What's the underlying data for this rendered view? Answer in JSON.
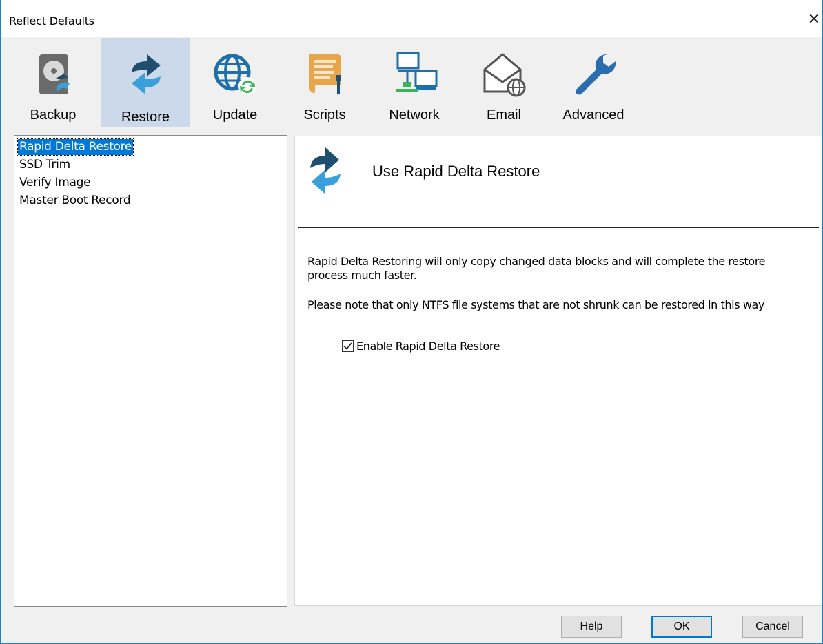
{
  "window": {
    "title": "Reflect Defaults",
    "close_glyph": "✕"
  },
  "toolbar": {
    "items": [
      {
        "label": "Backup",
        "icon": "backup-disk-icon"
      },
      {
        "label": "Restore",
        "icon": "restore-arrows-icon",
        "active": true
      },
      {
        "label": "Update",
        "icon": "update-globe-icon"
      },
      {
        "label": "Scripts",
        "icon": "scripts-scroll-icon"
      },
      {
        "label": "Network",
        "icon": "network-computers-icon"
      },
      {
        "label": "Email",
        "icon": "email-envelope-icon"
      },
      {
        "label": "Advanced",
        "icon": "wrench-icon"
      }
    ]
  },
  "sidebar": {
    "items": [
      {
        "label": "Rapid Delta Restore",
        "selected": true
      },
      {
        "label": "SSD Trim"
      },
      {
        "label": "Verify Image"
      },
      {
        "label": "Master Boot Record"
      }
    ]
  },
  "content": {
    "title": "Use Rapid Delta Restore",
    "description": "Rapid Delta Restoring will only copy changed data blocks and will complete the restore process much faster.",
    "note": "Please note that only NTFS file systems that are not shrunk can be restored in this way",
    "checkbox": {
      "label": "Enable Rapid Delta Restore",
      "checked": true
    }
  },
  "buttons": {
    "help": "Help",
    "ok": "OK",
    "cancel": "Cancel"
  },
  "colors": {
    "accent": "#0078d7",
    "active_tab": "#cbd9ea",
    "icon_dark": "#1f4e6e",
    "icon_light": "#3aa0dc"
  }
}
